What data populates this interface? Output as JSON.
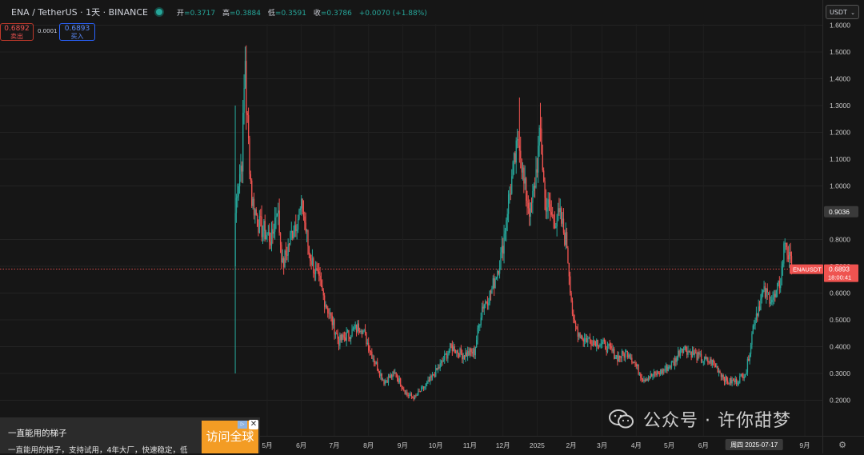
{
  "header": {
    "symbol": "ENA / TetherUS · 1天 · BINANCE",
    "open_label": "开",
    "open": "=0.3717",
    "high_label": "高",
    "high": "=0.3884",
    "low_label": "低",
    "low": "=0.3591",
    "close_label": "收",
    "close": "=0.3786",
    "change": "+0.0070 (+1.88%)"
  },
  "trade": {
    "sell_price": "0.6892",
    "sell_label": "卖出",
    "spread": "0.0001",
    "buy_price": "0.6893",
    "buy_label": "买入"
  },
  "currency_select": "USDT",
  "ad": {
    "title": "一直能用的梯子",
    "description": "一直能用的梯子，支持试用，4年大厂，快速稳定，低",
    "button": "访问全球",
    "badge": "广告"
  },
  "watermark": "公众号 · 许你甜梦",
  "colors": {
    "up": "#26a69a",
    "down": "#ef5350",
    "background": "#161616"
  },
  "chart_data": {
    "type": "candlestick",
    "title": "ENA / TetherUS · 1天 · BINANCE",
    "y_ticks": [
      "1.6000",
      "1.5000",
      "1.4000",
      "1.3000",
      "1.2000",
      "1.1000",
      "1.0000",
      "0.8000",
      "0.7000",
      "0.6000",
      "0.5000",
      "0.4000",
      "0.3000",
      "0.2000"
    ],
    "y_range": [
      0.15,
      1.63
    ],
    "x_ticks": [
      "5月",
      "6月",
      "7月",
      "8月",
      "9月",
      "10月",
      "11月",
      "12月",
      "2025",
      "2月",
      "3月",
      "4月",
      "5月",
      "6月",
      "9月"
    ],
    "crosshair_date": "周四 2025-07-17",
    "crosshair_price": "0.9036",
    "last_price": {
      "label": "ENAUSDT",
      "value": "0.6893",
      "countdown": "18:00:41"
    },
    "grid": true,
    "keypoints": [
      {
        "t": "2024-04-02",
        "close": 0.9
      },
      {
        "t": "2024-04-04",
        "close": 1.0
      },
      {
        "t": "2024-04-08",
        "close": 1.1
      },
      {
        "t": "2024-04-11",
        "close": 1.48
      },
      {
        "t": "2024-04-12",
        "close": 1.3
      },
      {
        "t": "2024-04-17",
        "close": 0.95
      },
      {
        "t": "2024-04-24",
        "close": 0.85
      },
      {
        "t": "2024-05-05",
        "close": 0.8
      },
      {
        "t": "2024-05-10",
        "close": 0.93
      },
      {
        "t": "2024-05-15",
        "close": 0.7
      },
      {
        "t": "2024-05-25",
        "close": 0.85
      },
      {
        "t": "2024-06-02",
        "close": 0.92
      },
      {
        "t": "2024-06-08",
        "close": 0.75
      },
      {
        "t": "2024-06-20",
        "close": 0.6
      },
      {
        "t": "2024-07-05",
        "close": 0.42
      },
      {
        "t": "2024-07-15",
        "close": 0.45
      },
      {
        "t": "2024-07-25",
        "close": 0.48
      },
      {
        "t": "2024-08-05",
        "close": 0.36
      },
      {
        "t": "2024-08-15",
        "close": 0.27
      },
      {
        "t": "2024-08-25",
        "close": 0.3
      },
      {
        "t": "2024-09-05",
        "close": 0.22
      },
      {
        "t": "2024-09-12",
        "close": 0.21
      },
      {
        "t": "2024-09-25",
        "close": 0.27
      },
      {
        "t": "2024-10-05",
        "close": 0.33
      },
      {
        "t": "2024-10-15",
        "close": 0.4
      },
      {
        "t": "2024-10-25",
        "close": 0.37
      },
      {
        "t": "2024-11-05",
        "close": 0.38
      },
      {
        "t": "2024-11-12",
        "close": 0.55
      },
      {
        "t": "2024-11-20",
        "close": 0.6
      },
      {
        "t": "2024-11-30",
        "close": 0.75
      },
      {
        "t": "2024-12-05",
        "close": 0.92
      },
      {
        "t": "2024-12-12",
        "close": 1.1
      },
      {
        "t": "2024-12-16",
        "close": 1.18
      },
      {
        "t": "2024-12-20",
        "close": 1.0
      },
      {
        "t": "2024-12-26",
        "close": 0.9
      },
      {
        "t": "2024-12-29",
        "close": 0.98
      },
      {
        "t": "2025-01-04",
        "close": 1.2
      },
      {
        "t": "2025-01-08",
        "close": 0.95
      },
      {
        "t": "2025-01-15",
        "close": 0.88
      },
      {
        "t": "2025-01-22",
        "close": 0.88
      },
      {
        "t": "2025-01-28",
        "close": 0.78
      },
      {
        "t": "2025-02-03",
        "close": 0.48
      },
      {
        "t": "2025-02-12",
        "close": 0.43
      },
      {
        "t": "2025-02-25",
        "close": 0.42
      },
      {
        "t": "2025-03-05",
        "close": 0.4
      },
      {
        "t": "2025-03-15",
        "close": 0.36
      },
      {
        "t": "2025-03-25",
        "close": 0.38
      },
      {
        "t": "2025-04-07",
        "close": 0.28
      },
      {
        "t": "2025-04-15",
        "close": 0.29
      },
      {
        "t": "2025-04-25",
        "close": 0.31
      },
      {
        "t": "2025-05-05",
        "close": 0.34
      },
      {
        "t": "2025-05-12",
        "close": 0.4
      },
      {
        "t": "2025-05-20",
        "close": 0.38
      },
      {
        "t": "2025-06-01",
        "close": 0.35
      },
      {
        "t": "2025-06-10",
        "close": 0.34
      },
      {
        "t": "2025-06-22",
        "close": 0.27
      },
      {
        "t": "2025-07-01",
        "close": 0.27
      },
      {
        "t": "2025-07-10",
        "close": 0.31
      },
      {
        "t": "2025-07-17",
        "close": 0.5
      },
      {
        "t": "2025-07-25",
        "close": 0.6
      },
      {
        "t": "2025-08-05",
        "close": 0.58
      },
      {
        "t": "2025-08-10",
        "close": 0.65
      },
      {
        "t": "2025-08-14",
        "close": 0.8
      },
      {
        "t": "2025-08-17",
        "close": 0.74
      },
      {
        "t": "2025-08-20",
        "close": 0.69
      }
    ]
  }
}
